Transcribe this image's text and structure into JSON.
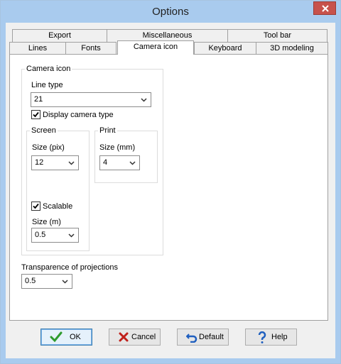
{
  "window": {
    "title": "Options"
  },
  "tabs_back_row": [
    {
      "label": "Export"
    },
    {
      "label": "Miscellaneous"
    },
    {
      "label": "Tool bar"
    }
  ],
  "tabs_front_row": [
    {
      "label": "Lines"
    },
    {
      "label": "Fonts"
    },
    {
      "label": "Camera icon",
      "active": true
    },
    {
      "label": "Keyboard"
    },
    {
      "label": "3D modeling"
    }
  ],
  "camera_icon": {
    "group_label": "Camera icon",
    "line_type_label": "Line type",
    "line_type_value": "21",
    "display_camera_type_label": "Display camera type",
    "display_camera_type_checked": true,
    "screen": {
      "group_label": "Screen",
      "size_label": "Size (pix)",
      "size_value": "12",
      "scalable_label": "Scalable",
      "scalable_checked": true,
      "size_m_label": "Size (m)",
      "size_m_value": "0.5"
    },
    "print": {
      "group_label": "Print",
      "size_label": "Size (mm)",
      "size_value": "4"
    }
  },
  "transparence": {
    "label": "Transparence of projections",
    "value": "0.5"
  },
  "buttons": {
    "ok": "OK",
    "cancel": "Cancel",
    "default": "Default",
    "help": "Help"
  },
  "colors": {
    "title_bar": "#a9cbee",
    "close_button": "#c7524b",
    "panel": "#ffffff",
    "dialog_bg": "#f0f0f0"
  }
}
